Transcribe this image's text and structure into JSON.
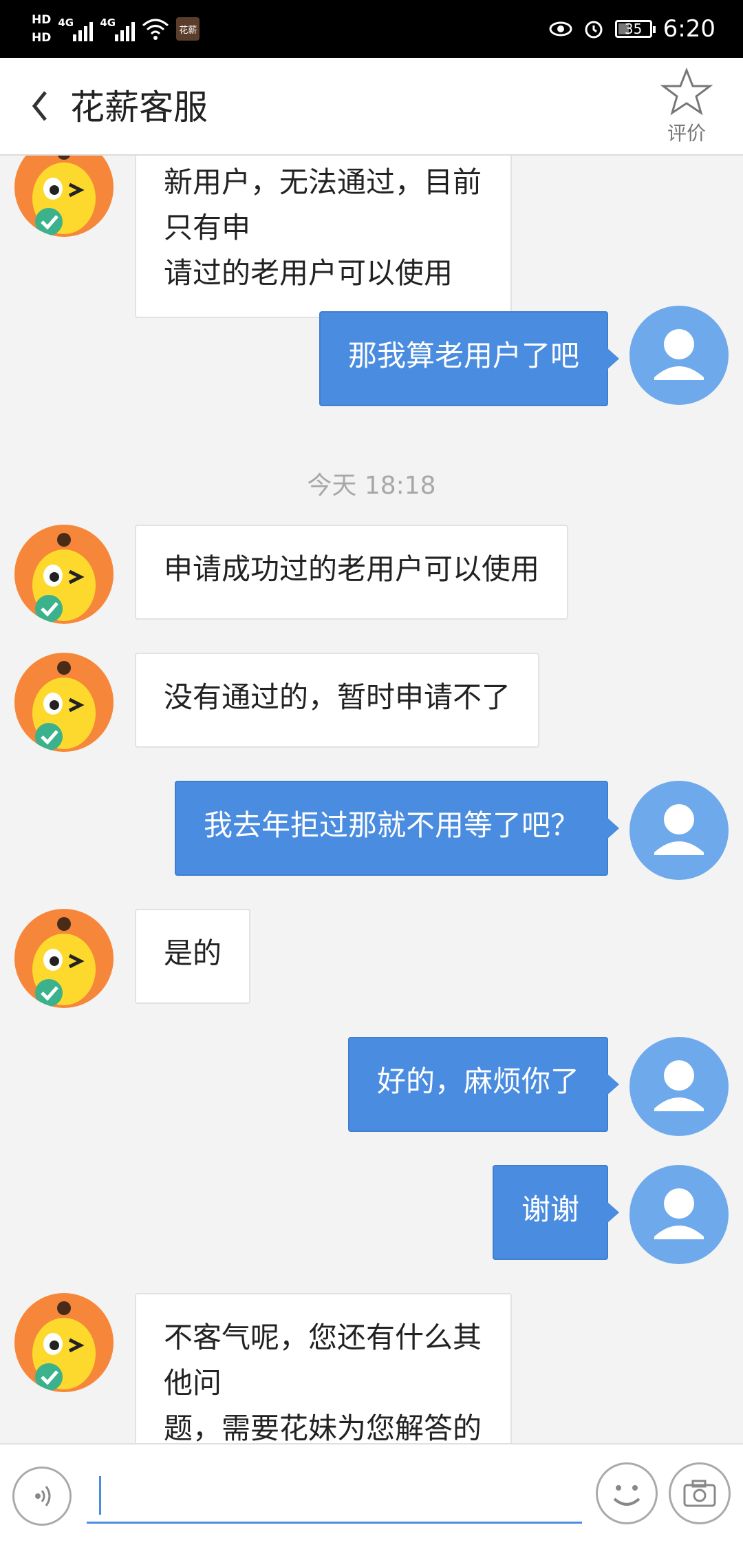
{
  "status_bar": {
    "hd1": "HD",
    "hd2": "HD",
    "net1": "4G",
    "net2": "4G",
    "app_badge": "花薪",
    "battery": "35",
    "time": "6:20"
  },
  "header": {
    "title": "花薪客服",
    "rate_label": "评价"
  },
  "messages": [
    {
      "side": "left",
      "text_lines": [
        "新用户，无法通过，目前只有申",
        "请过的老用户可以使用"
      ]
    },
    {
      "side": "right",
      "text": "那我算老用户了吧"
    },
    {
      "type": "time",
      "text": "今天 18:18"
    },
    {
      "side": "left",
      "text": "申请成功过的老用户可以使用"
    },
    {
      "side": "left",
      "text": "没有通过的，暂时申请不了"
    },
    {
      "side": "right",
      "text": "我去年拒过那就不用等了吧？"
    },
    {
      "side": "left",
      "text": "是的"
    },
    {
      "side": "right",
      "text": "好的，麻烦你了"
    },
    {
      "side": "right",
      "text": "谢谢"
    },
    {
      "side": "left",
      "text_lines": [
        "不客气呢，您还有什么其他问",
        "题，需要花妹为您解答的吗"
      ]
    }
  ],
  "input": {
    "placeholder": ""
  },
  "colors": {
    "user_bubble": "#4a8cdf",
    "bot_avatar": "#f6873a",
    "user_avatar": "#6ea9eb",
    "background": "#f3f3f3"
  },
  "icons": [
    "back-chevron-icon",
    "star-icon",
    "voice-icon",
    "emoji-icon",
    "camera-icon"
  ]
}
